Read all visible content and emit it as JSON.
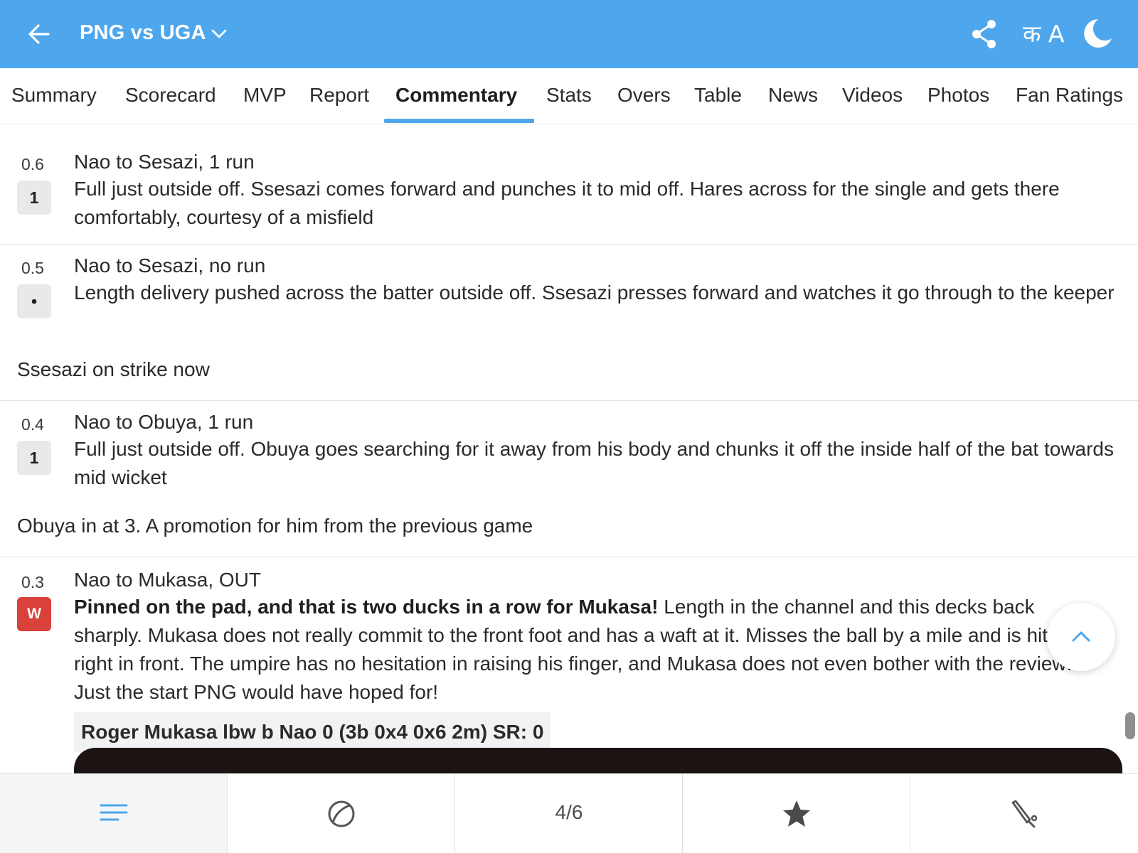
{
  "header": {
    "title": "PNG vs UGA",
    "lang_toggle": "क A",
    "colors": {
      "primary": "#4ea6ec",
      "wicket": "#d9413b"
    },
    "icons": [
      "back-arrow-icon",
      "chevron-down-icon",
      "share-icon",
      "language-icon",
      "moon-icon"
    ]
  },
  "tabs": [
    {
      "label": "Summary"
    },
    {
      "label": "Scorecard"
    },
    {
      "label": "MVP"
    },
    {
      "label": "Report"
    },
    {
      "label": "Commentary",
      "active": true
    },
    {
      "label": "Stats"
    },
    {
      "label": "Overs"
    },
    {
      "label": "Table"
    },
    {
      "label": "News"
    },
    {
      "label": "Videos"
    },
    {
      "label": "Photos"
    },
    {
      "label": "Fan Ratings"
    }
  ],
  "commentary": [
    {
      "over": "0.6",
      "result": "1",
      "headline": "Nao to Sesazi, 1 run",
      "text": "Full just outside off. Ssesazi comes forward and punches it to mid off. Hares across for the single and gets there comfortably, courtesy of a misfield"
    },
    {
      "over": "0.5",
      "result": "•",
      "headline": "Nao to Sesazi, no run",
      "text": "Length delivery pushed across the batter outside off. Ssesazi presses forward and watches it go through to the keeper",
      "note": "Ssesazi on strike now"
    },
    {
      "over": "0.4",
      "result": "1",
      "headline": "Nao to Obuya, 1 run",
      "text": "Full just outside off. Obuya goes searching for it away from his body and chunks it off the inside half of the bat towards mid wicket",
      "note": "Obuya in at 3. A promotion for him from the previous game"
    },
    {
      "over": "0.3",
      "result": "W",
      "headline": "Nao to Mukasa, OUT",
      "text_bold": "Pinned on the pad, and that is two ducks in a row for Mukasa!",
      "text": " Length in the channel and this decks back sharply. Mukasa does not really commit to the front foot and has a waft at it. Misses the ball by a mile and is hit him right in front. The umpire has no hesitation in raising his finger, and Mukasa does not even bother with the review! Just the start PNG would have hoped for!",
      "dismissal": "Roger Mukasa lbw b Nao 0 (3b 0x4 0x6 2m) SR: 0"
    }
  ],
  "bottom_nav": {
    "pager": "4/6",
    "icons": [
      "menu-lines-icon",
      "ball-icon",
      "star-icon",
      "bat-icon"
    ]
  }
}
